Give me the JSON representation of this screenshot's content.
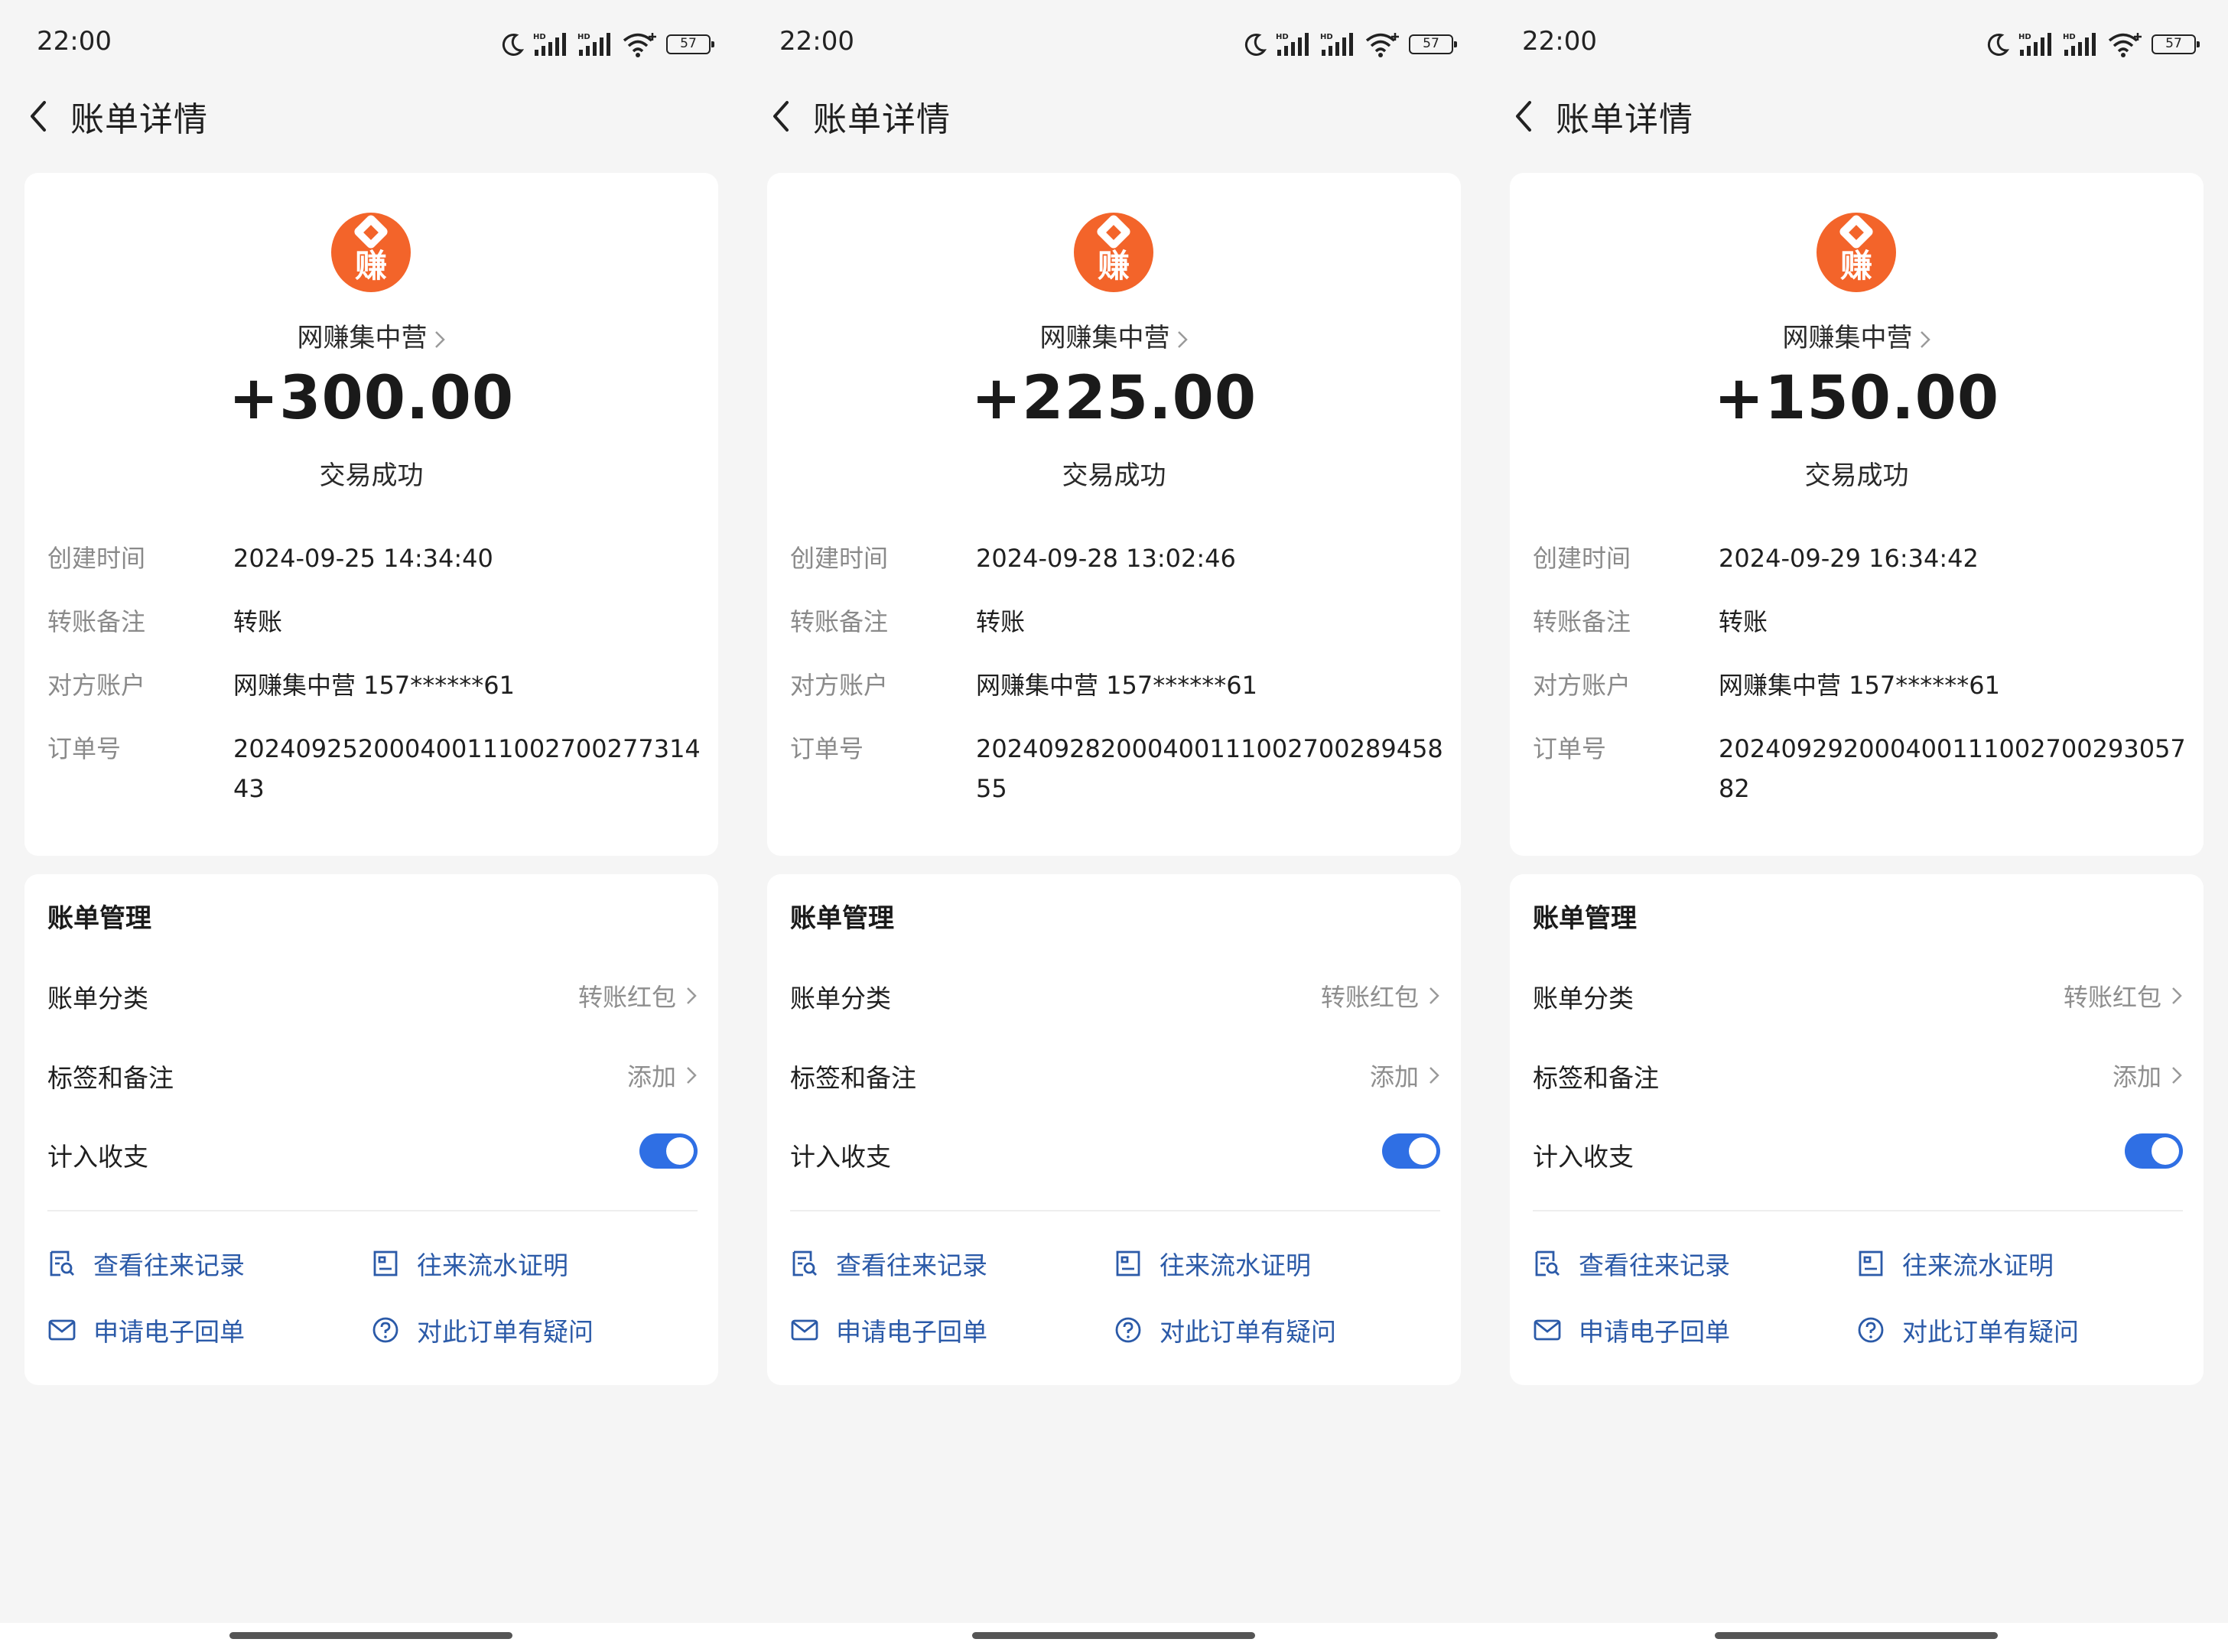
{
  "status_bar": {
    "time": "22:00",
    "battery": "57",
    "icons": [
      "moon-icon",
      "hd-signal-icon",
      "hd-signal-icon",
      "wifi-icon",
      "battery-icon"
    ]
  },
  "nav": {
    "title": "账单详情",
    "back_icon": "chevron-left-icon"
  },
  "labels": {
    "created_time": "创建时间",
    "remark": "转账备注",
    "counterparty": "对方账户",
    "order_no": "订单号",
    "manage_title": "账单管理",
    "category": "账单分类",
    "tags": "标签和备注",
    "include": "计入收支",
    "view_records": "查看往来记录",
    "flow_proof": "往来流水证明",
    "e_receipt": "申请电子回单",
    "question": "对此订单有疑问"
  },
  "bills": [
    {
      "merchant_logo_char": "赚",
      "merchant": "网赚集中营",
      "amount": "+300.00",
      "status": "交易成功",
      "created_time": "2024-09-25 14:34:40",
      "remark": "转账",
      "counterparty": "网赚集中营 157******61",
      "order_no": "20240925200040011100270027731443",
      "category_value": "转账红包",
      "tags_value": "添加",
      "include_enabled": true
    },
    {
      "merchant_logo_char": "赚",
      "merchant": "网赚集中营",
      "amount": "+225.00",
      "status": "交易成功",
      "created_time": "2024-09-28 13:02:46",
      "remark": "转账",
      "counterparty": "网赚集中营 157******61",
      "order_no": "202409282000400111002700289458 55",
      "category_value": "转账红包",
      "tags_value": "添加",
      "include_enabled": true
    },
    {
      "merchant_logo_char": "赚",
      "merchant": "网赚集中营",
      "amount": "+150.00",
      "status": "交易成功",
      "created_time": "2024-09-29 16:34:42",
      "remark": "转账",
      "counterparty": "网赚集中营 157******61",
      "order_no": "20240929200040011100270029305782",
      "category_value": "转账红包",
      "tags_value": "添加",
      "include_enabled": true
    }
  ],
  "colors": {
    "accent": "#2f6fe4",
    "link": "#2b5aa8",
    "logo": "#f3642a",
    "background": "#f5f5f5"
  }
}
